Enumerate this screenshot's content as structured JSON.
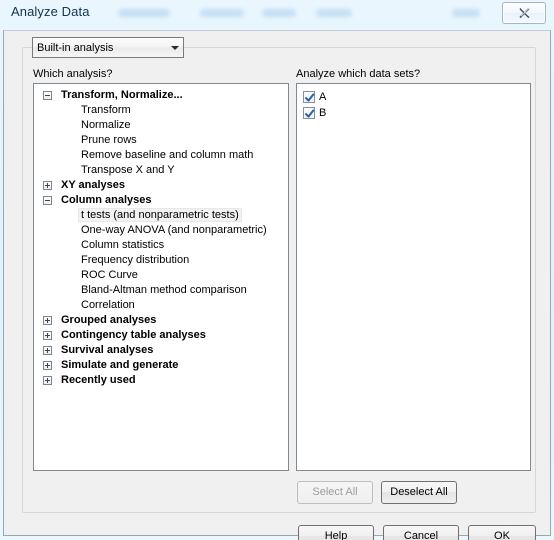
{
  "window": {
    "title": "Analyze Data",
    "close_icon": "close-icon"
  },
  "toolbar": {
    "analysis_source_value": "Built-in analysis",
    "analysis_source_options": [
      "Built-in analysis"
    ],
    "dropdown_icon": "chevron-down-icon"
  },
  "left_pane": {
    "label": "Which analysis?",
    "tree": [
      {
        "label": "Transform, Normalize...",
        "type": "group",
        "expanded": true,
        "expander": "minus-box-icon"
      },
      {
        "label": "Transform",
        "type": "child"
      },
      {
        "label": "Normalize",
        "type": "child"
      },
      {
        "label": "Prune rows",
        "type": "child"
      },
      {
        "label": "Remove baseline and column math",
        "type": "child"
      },
      {
        "label": "Transpose X and Y",
        "type": "child"
      },
      {
        "label": "XY analyses",
        "type": "group",
        "expanded": false,
        "expander": "plus-box-icon"
      },
      {
        "label": "Column analyses",
        "type": "group",
        "expanded": true,
        "expander": "minus-box-icon"
      },
      {
        "label": "t tests (and nonparametric tests)",
        "type": "child",
        "hover": true
      },
      {
        "label": "One-way ANOVA (and nonparametric)",
        "type": "child"
      },
      {
        "label": "Column statistics",
        "type": "child"
      },
      {
        "label": "Frequency distribution",
        "type": "child"
      },
      {
        "label": "ROC Curve",
        "type": "child"
      },
      {
        "label": "Bland-Altman method comparison",
        "type": "child"
      },
      {
        "label": "Correlation",
        "type": "child"
      },
      {
        "label": "Grouped analyses",
        "type": "group",
        "expanded": false,
        "expander": "plus-box-icon"
      },
      {
        "label": "Contingency table analyses",
        "type": "group",
        "expanded": false,
        "expander": "plus-box-icon"
      },
      {
        "label": "Survival analyses",
        "type": "group",
        "expanded": false,
        "expander": "plus-box-icon"
      },
      {
        "label": "Simulate and generate",
        "type": "group",
        "expanded": false,
        "expander": "plus-box-icon"
      },
      {
        "label": "Recently used",
        "type": "group",
        "expanded": false,
        "expander": "plus-box-icon"
      }
    ]
  },
  "right_pane": {
    "label": "Analyze which data sets?",
    "datasets": [
      {
        "label": "A",
        "checked": true
      },
      {
        "label": "B",
        "checked": true
      }
    ],
    "select_all_label": "Select All",
    "select_all_enabled": false,
    "deselect_all_label": "Deselect All",
    "deselect_all_enabled": true
  },
  "footer": {
    "help_label": "Help",
    "cancel_label": "Cancel",
    "ok_label": "OK"
  },
  "colors": {
    "glass": "#dff1fb",
    "dialog_face": "#f0f0f0",
    "checkmark": "#2c5fa8",
    "title_text": "#12344f"
  }
}
